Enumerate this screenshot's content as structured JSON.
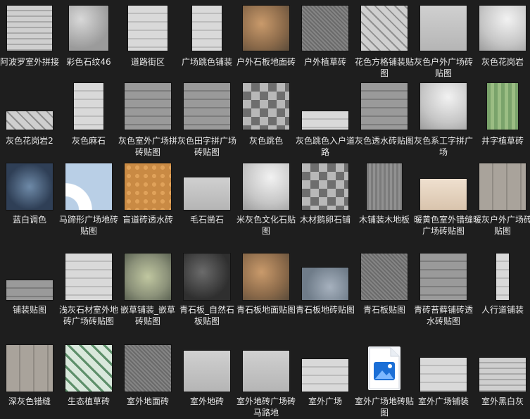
{
  "items": [
    {
      "label": "阿波罗室外拼接",
      "icon": "texture-thumbnail-icon"
    },
    {
      "label": "彩色石纹46",
      "icon": "texture-thumbnail-icon"
    },
    {
      "label": "道路街区",
      "icon": "texture-thumbnail-icon"
    },
    {
      "label": "广场跳色铺装",
      "icon": "texture-thumbnail-icon"
    },
    {
      "label": "户外石板地面砖",
      "icon": "texture-thumbnail-icon"
    },
    {
      "label": "户外植草砖",
      "icon": "texture-thumbnail-icon"
    },
    {
      "label": "花色方格铺装贴图",
      "icon": "texture-thumbnail-icon"
    },
    {
      "label": "灰色户外广场砖贴图",
      "icon": "texture-thumbnail-icon"
    },
    {
      "label": "灰色花岗岩",
      "icon": "texture-thumbnail-icon"
    },
    {
      "label": "灰色花岗岩2",
      "icon": "texture-thumbnail-icon"
    },
    {
      "label": "灰色麻石",
      "icon": "texture-thumbnail-icon"
    },
    {
      "label": "灰色室外广场拼砖贴图",
      "icon": "texture-thumbnail-icon"
    },
    {
      "label": "灰色田字拼广场砖贴图",
      "icon": "texture-thumbnail-icon"
    },
    {
      "label": "灰色跳色",
      "icon": "texture-thumbnail-icon"
    },
    {
      "label": "灰色跳色入户道路",
      "icon": "texture-thumbnail-icon"
    },
    {
      "label": "灰色透水砖贴图",
      "icon": "texture-thumbnail-icon"
    },
    {
      "label": "灰色系工字拼广场",
      "icon": "texture-thumbnail-icon"
    },
    {
      "label": "井字植草砖",
      "icon": "texture-thumbnail-icon"
    },
    {
      "label": "蓝白调色",
      "icon": "texture-thumbnail-icon"
    },
    {
      "label": "马蹄形广场地砖贴图",
      "icon": "texture-thumbnail-icon"
    },
    {
      "label": "盲道砖透水砖",
      "icon": "texture-thumbnail-icon"
    },
    {
      "label": "毛石凿石",
      "icon": "texture-thumbnail-icon"
    },
    {
      "label": "米灰色文化石贴图",
      "icon": "texture-thumbnail-icon"
    },
    {
      "label": "木材鹅卵石铺",
      "icon": "texture-thumbnail-icon"
    },
    {
      "label": "木铺装木地板",
      "icon": "texture-thumbnail-icon"
    },
    {
      "label": "暖黄色室外错缝广场砖贴图",
      "icon": "texture-thumbnail-icon"
    },
    {
      "label": "暖灰户外广场砖贴图",
      "icon": "texture-thumbnail-icon"
    },
    {
      "label": "铺装贴图",
      "icon": "texture-thumbnail-icon"
    },
    {
      "label": "浅灰石材室外地砖广场砖贴图",
      "icon": "texture-thumbnail-icon"
    },
    {
      "label": "嵌草铺装_嵌草砖贴图",
      "icon": "texture-thumbnail-icon"
    },
    {
      "label": "青石板_自然石板贴图",
      "icon": "texture-thumbnail-icon"
    },
    {
      "label": "青石板地面贴图",
      "icon": "texture-thumbnail-icon"
    },
    {
      "label": "青石板地砖贴图",
      "icon": "texture-thumbnail-icon"
    },
    {
      "label": "青石板贴图",
      "icon": "texture-thumbnail-icon"
    },
    {
      "label": "青砖苔藓铺砖透水砖贴图",
      "icon": "texture-thumbnail-icon"
    },
    {
      "label": "人行道铺装",
      "icon": "texture-thumbnail-icon"
    },
    {
      "label": "深灰色错缝",
      "icon": "texture-thumbnail-icon"
    },
    {
      "label": "生态植草砖",
      "icon": "texture-thumbnail-icon"
    },
    {
      "label": "室外地面砖",
      "icon": "texture-thumbnail-icon"
    },
    {
      "label": "室外地砖",
      "icon": "texture-thumbnail-icon"
    },
    {
      "label": "室外地砖广场砖马路地",
      "icon": "texture-thumbnail-icon"
    },
    {
      "label": "室外广场",
      "icon": "texture-thumbnail-icon"
    },
    {
      "label": "室外广场地砖贴图",
      "icon": "image-file-icon"
    },
    {
      "label": "室外广场铺装",
      "icon": "texture-thumbnail-icon"
    },
    {
      "label": "室外黑白灰",
      "icon": "texture-thumbnail-icon"
    }
  ]
}
